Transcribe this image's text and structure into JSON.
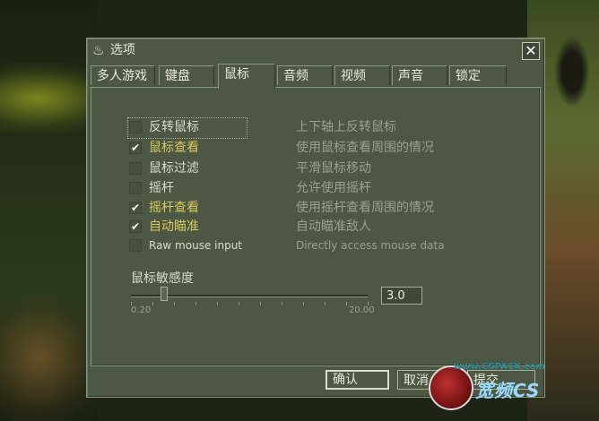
{
  "window": {
    "title": "选项",
    "close_glyph": "✕",
    "steam_glyph": "♨"
  },
  "tabs": [
    {
      "label": "多人游戏"
    },
    {
      "label": "键盘"
    },
    {
      "label": "鼠标",
      "active": true
    },
    {
      "label": "音频"
    },
    {
      "label": "视频"
    },
    {
      "label": "声音"
    },
    {
      "label": "锁定"
    }
  ],
  "options": [
    {
      "label": "反转鼠标",
      "checked": false,
      "description": "上下轴上反转鼠标"
    },
    {
      "label": "鼠标查看",
      "checked": true,
      "description": "使用鼠标查看周围的情况"
    },
    {
      "label": "鼠标过滤",
      "checked": false,
      "description": "平滑鼠标移动"
    },
    {
      "label": "摇杆",
      "checked": false,
      "description": "允许使用摇杆"
    },
    {
      "label": "摇杆查看",
      "checked": true,
      "description": "使用摇杆查看周围的情况"
    },
    {
      "label": "自动瞄准",
      "checked": true,
      "description": "自动瞄准敌人"
    },
    {
      "label": "Raw mouse input",
      "checked": false,
      "description": "Directly access mouse data"
    }
  ],
  "check_glyph": "✔",
  "sensitivity": {
    "label": "鼠标敏感度",
    "min": "0.20",
    "max": "20.00",
    "value": "3.0",
    "fraction": 0.14
  },
  "buttons": {
    "ok": "确认",
    "cancel": "取消",
    "apply": "提交"
  },
  "watermark": {
    "url": "www.CSPACK.com",
    "logo": "宽频CS"
  }
}
